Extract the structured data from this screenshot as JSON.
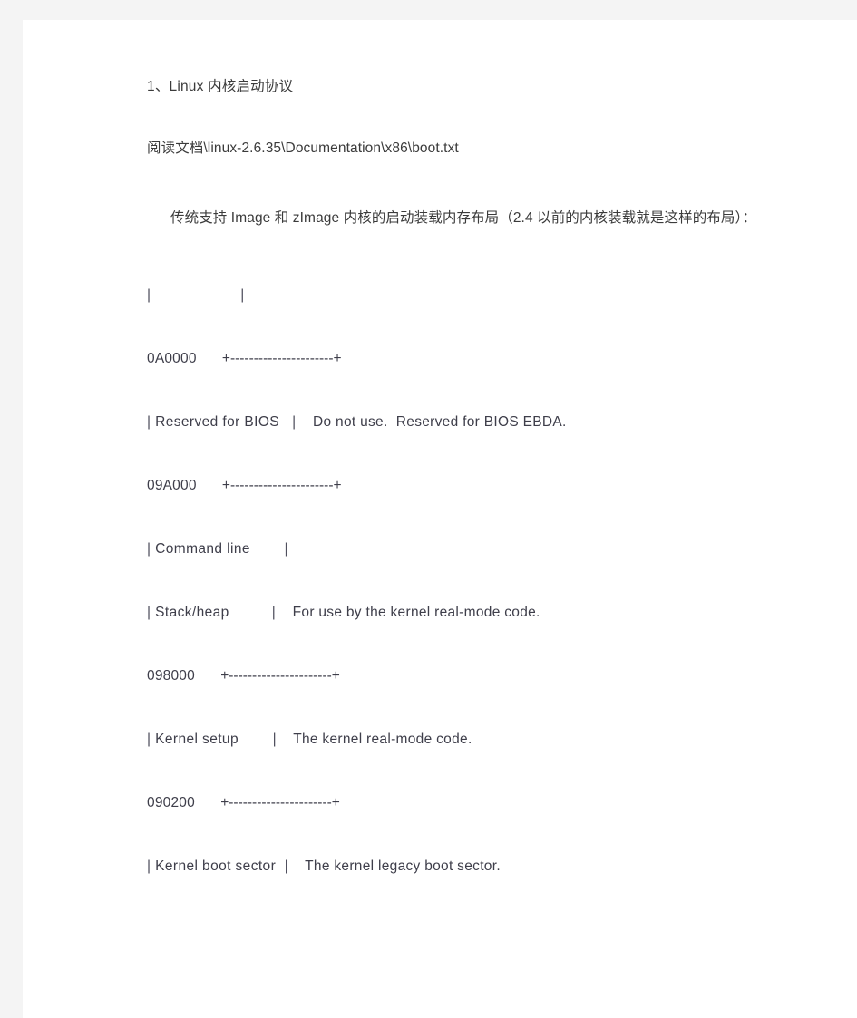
{
  "document": {
    "heading": "1、Linux 内核启动协议",
    "reference_line": "阅读文档\\linux-2.6.35\\Documentation\\x86\\boot.txt",
    "intro_paragraph": "传统支持 Image 和 zImage 内核的启动装载内存布局（2.4 以前的内核装载就是这样的布局）：",
    "colors": {
      "page_background": "#f4f4f4",
      "content_background": "#ffffff",
      "text": "#3b3b3b",
      "diagram_text": "#3e3e4a"
    },
    "memory_layout_diagram": {
      "title": "Traditional Image/zImage kernel boot memory layout",
      "lines": [
        {
          "addr": "",
          "gap": "",
          "bar": "|",
          "label": "",
          "bar2": "|",
          "desc": "",
          "kind": "open-box"
        },
        {
          "addr": "0A0000",
          "gap": "    ",
          "bar": "",
          "label": "",
          "bar2": "",
          "desc": "",
          "rule": "+----------------------+",
          "kind": "rule"
        },
        {
          "addr": "",
          "gap": "",
          "bar": "|",
          "label": " Reserved for BIOS",
          "bar2": "|",
          "desc": "Do not use.  Reserved for BIOS EBDA.",
          "kind": "row"
        },
        {
          "addr": "09A000",
          "gap": "    ",
          "bar": "",
          "label": "",
          "bar2": "",
          "desc": "",
          "rule": "+----------------------+",
          "kind": "rule"
        },
        {
          "addr": "",
          "gap": "",
          "bar": "|",
          "label": " Command line",
          "bar2": "|",
          "desc": "",
          "kind": "row"
        },
        {
          "addr": "",
          "gap": "",
          "bar": "|",
          "label": " Stack/heap",
          "bar2": "|",
          "desc": "For use by the kernel real-mode code.",
          "kind": "row"
        },
        {
          "addr": "098000",
          "gap": "    ",
          "bar": "",
          "label": "",
          "bar2": "",
          "desc": "",
          "rule": "+----------------------+",
          "kind": "rule"
        },
        {
          "addr": "",
          "gap": "",
          "bar": "|",
          "label": " Kernel setup",
          "bar2": "|",
          "desc": "The kernel real-mode code.",
          "kind": "row"
        },
        {
          "addr": "090200",
          "gap": "    ",
          "bar": "",
          "label": "",
          "bar2": "",
          "desc": "",
          "rule": "+----------------------+",
          "kind": "rule"
        },
        {
          "addr": "",
          "gap": "",
          "bar": "|",
          "label": " Kernel boot sector",
          "bar2": "|",
          "desc": "The kernel legacy boot sector.",
          "kind": "row"
        }
      ],
      "raw_lines": [
        "|          |",
        "0A0000    +----------------------+",
        "| Reserved for BIOS    |    Do not use.  Reserved for BIOS EBDA.",
        "09A000    +----------------------+",
        "| Command line         |",
        "| Stack/heap           |    For use by the kernel real-mode code.",
        "098000    +----------------------+",
        "| Kernel setup         |    The kernel real-mode code.",
        "090200    +----------------------+",
        "| Kernel boot sector   |    The kernel legacy boot sector."
      ]
    }
  }
}
